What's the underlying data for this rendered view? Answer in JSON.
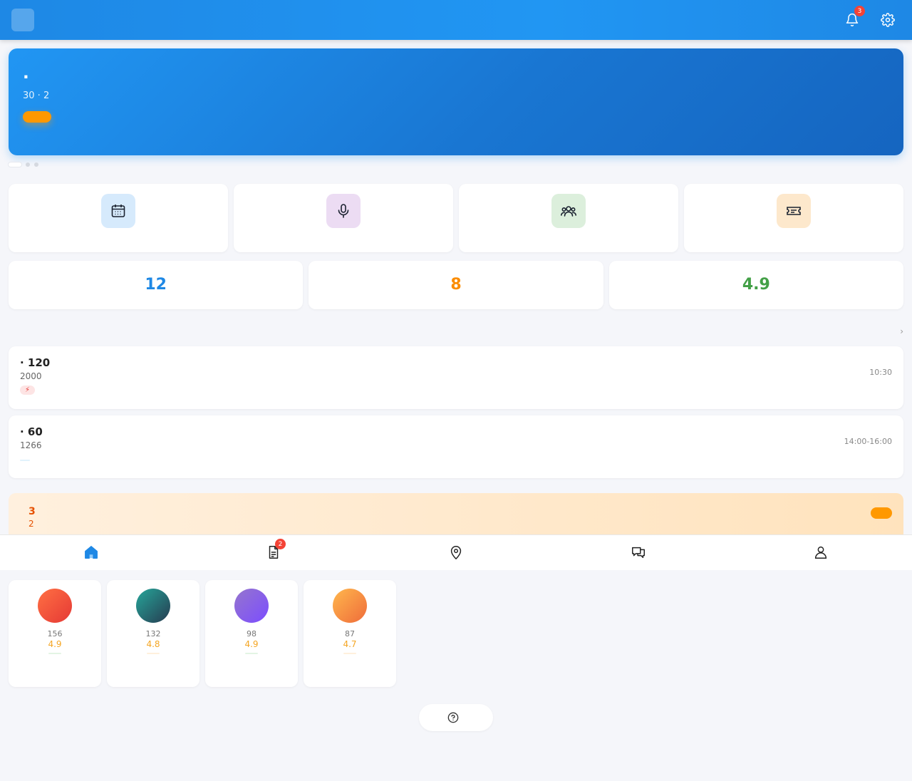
{
  "header": {
    "logo_glyph": "",
    "title": "",
    "notification_count": "3"
  },
  "banner": {
    "title": " · ",
    "subtitle": "30 · 2",
    "button": "",
    "art_glyph": ""
  },
  "quick_actions": [
    {
      "label": "",
      "icon": "calendar-icon",
      "bg": "#d6eafc"
    },
    {
      "label": "",
      "icon": "microphone-icon",
      "bg": "#ecdcf3"
    },
    {
      "label": "",
      "icon": "group-icon",
      "bg": "#dcefdc"
    },
    {
      "label": "",
      "icon": "ticket-icon",
      "bg": "#fde8cc"
    }
  ],
  "stats": [
    {
      "value": "12",
      "label": "",
      "color": "#1e88e5"
    },
    {
      "value": "8",
      "label": "",
      "color": "#fb8c00"
    },
    {
      "value": "4.9",
      "label": "",
      "color": "#43a047"
    }
  ],
  "events_section": {
    "title": " ",
    "more": " ›"
  },
  "events": [
    {
      "title": " · 120",
      "subtitle": "2000",
      "tag": " ⚡",
      "time": "10:30",
      "location": ""
    },
    {
      "title": " · 60",
      "subtitle": "1266",
      "tag": "",
      "time": "14:00-16:00",
      "location": ""
    }
  ],
  "coupon": {
    "icon_glyph": "",
    "title": "3",
    "subtitle": "2",
    "button": ""
  },
  "partners_section": {
    "title": " ",
    "more": ""
  },
  "partners": [
    {
      "glyph": "",
      "name": "",
      "meta": " 156",
      "rating": " 4.9",
      "tag": ""
    },
    {
      "glyph": "",
      "name": "",
      "meta": " 132",
      "rating": " 4.8",
      "tag": ""
    },
    {
      "glyph": "",
      "name": "",
      "meta": " 98",
      "rating": " 4.9",
      "tag": ""
    },
    {
      "glyph": "",
      "name": "",
      "meta": " 87",
      "rating": " 4.7",
      "tag": ""
    }
  ],
  "help": {
    "label": ""
  },
  "bottom_nav": [
    {
      "label": "",
      "icon": "home-icon"
    },
    {
      "label": "",
      "icon": "document-icon",
      "badge": "2"
    },
    {
      "label": "",
      "icon": "location-pin-icon"
    },
    {
      "label": "",
      "icon": "chat-icon"
    },
    {
      "label": "",
      "icon": "user-icon"
    }
  ]
}
